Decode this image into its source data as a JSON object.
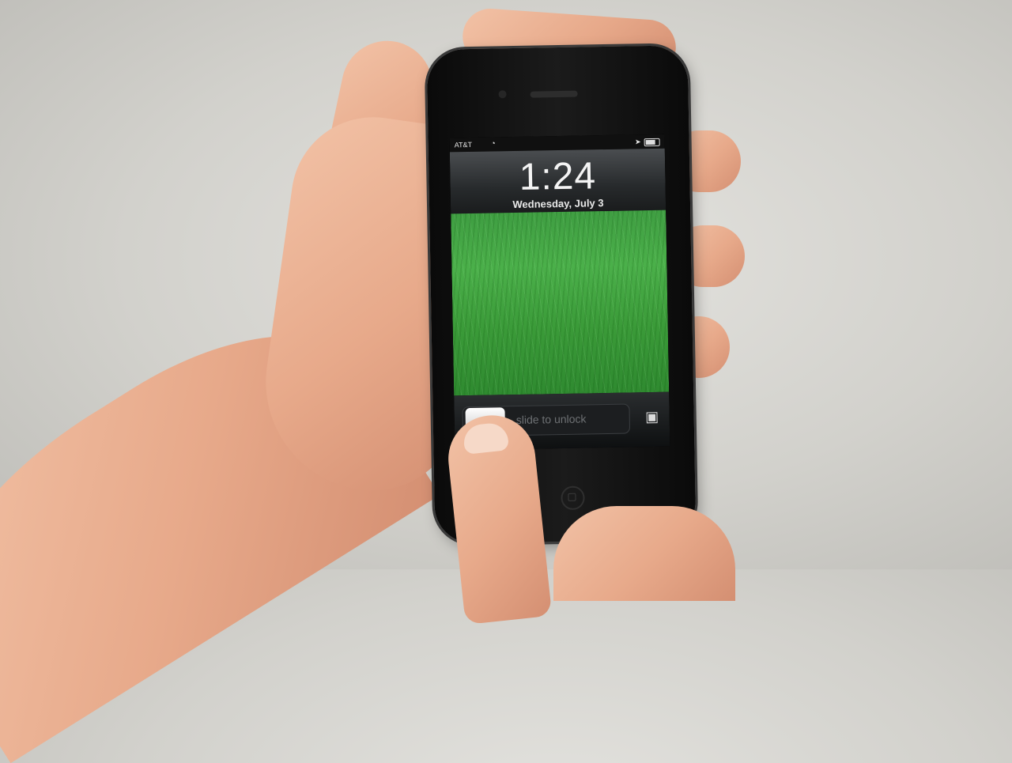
{
  "photo": {
    "description_tag": "hand-holding-phone-lockscreen"
  },
  "lockscreen": {
    "carrier": "AT&T",
    "time": "1:24",
    "date": "Wednesday, July 3",
    "slide_label": "slide to unlock",
    "wallpaper": "grass"
  },
  "icons": {
    "wifi": "wifi-icon",
    "battery": "battery-icon",
    "location": "location-arrow-icon",
    "camera": "camera-icon"
  },
  "colors": {
    "grass": "#4bb04a",
    "background": "#d2d1cc",
    "phone_body": "#111111"
  }
}
